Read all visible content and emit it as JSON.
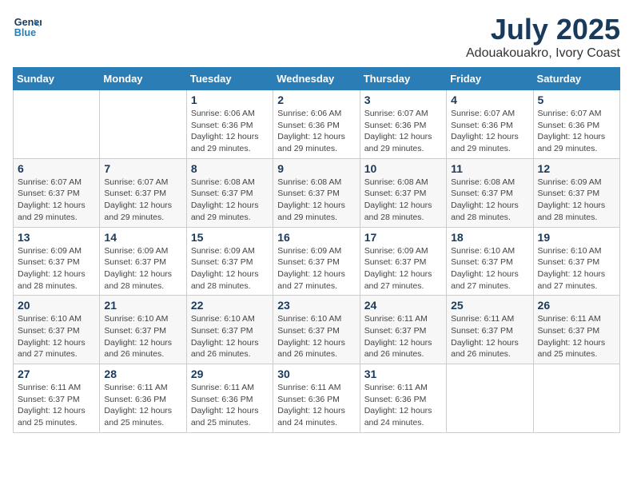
{
  "header": {
    "logo_line1": "General",
    "logo_line2": "Blue",
    "month": "July 2025",
    "location": "Adouakouakro, Ivory Coast"
  },
  "weekdays": [
    "Sunday",
    "Monday",
    "Tuesday",
    "Wednesday",
    "Thursday",
    "Friday",
    "Saturday"
  ],
  "weeks": [
    [
      null,
      null,
      {
        "day": 1,
        "sunrise": "6:06 AM",
        "sunset": "6:36 PM",
        "daylight": "12 hours and 29 minutes."
      },
      {
        "day": 2,
        "sunrise": "6:06 AM",
        "sunset": "6:36 PM",
        "daylight": "12 hours and 29 minutes."
      },
      {
        "day": 3,
        "sunrise": "6:07 AM",
        "sunset": "6:36 PM",
        "daylight": "12 hours and 29 minutes."
      },
      {
        "day": 4,
        "sunrise": "6:07 AM",
        "sunset": "6:36 PM",
        "daylight": "12 hours and 29 minutes."
      },
      {
        "day": 5,
        "sunrise": "6:07 AM",
        "sunset": "6:36 PM",
        "daylight": "12 hours and 29 minutes."
      }
    ],
    [
      {
        "day": 6,
        "sunrise": "6:07 AM",
        "sunset": "6:37 PM",
        "daylight": "12 hours and 29 minutes."
      },
      {
        "day": 7,
        "sunrise": "6:07 AM",
        "sunset": "6:37 PM",
        "daylight": "12 hours and 29 minutes."
      },
      {
        "day": 8,
        "sunrise": "6:08 AM",
        "sunset": "6:37 PM",
        "daylight": "12 hours and 29 minutes."
      },
      {
        "day": 9,
        "sunrise": "6:08 AM",
        "sunset": "6:37 PM",
        "daylight": "12 hours and 29 minutes."
      },
      {
        "day": 10,
        "sunrise": "6:08 AM",
        "sunset": "6:37 PM",
        "daylight": "12 hours and 28 minutes."
      },
      {
        "day": 11,
        "sunrise": "6:08 AM",
        "sunset": "6:37 PM",
        "daylight": "12 hours and 28 minutes."
      },
      {
        "day": 12,
        "sunrise": "6:09 AM",
        "sunset": "6:37 PM",
        "daylight": "12 hours and 28 minutes."
      }
    ],
    [
      {
        "day": 13,
        "sunrise": "6:09 AM",
        "sunset": "6:37 PM",
        "daylight": "12 hours and 28 minutes."
      },
      {
        "day": 14,
        "sunrise": "6:09 AM",
        "sunset": "6:37 PM",
        "daylight": "12 hours and 28 minutes."
      },
      {
        "day": 15,
        "sunrise": "6:09 AM",
        "sunset": "6:37 PM",
        "daylight": "12 hours and 28 minutes."
      },
      {
        "day": 16,
        "sunrise": "6:09 AM",
        "sunset": "6:37 PM",
        "daylight": "12 hours and 27 minutes."
      },
      {
        "day": 17,
        "sunrise": "6:09 AM",
        "sunset": "6:37 PM",
        "daylight": "12 hours and 27 minutes."
      },
      {
        "day": 18,
        "sunrise": "6:10 AM",
        "sunset": "6:37 PM",
        "daylight": "12 hours and 27 minutes."
      },
      {
        "day": 19,
        "sunrise": "6:10 AM",
        "sunset": "6:37 PM",
        "daylight": "12 hours and 27 minutes."
      }
    ],
    [
      {
        "day": 20,
        "sunrise": "6:10 AM",
        "sunset": "6:37 PM",
        "daylight": "12 hours and 27 minutes."
      },
      {
        "day": 21,
        "sunrise": "6:10 AM",
        "sunset": "6:37 PM",
        "daylight": "12 hours and 26 minutes."
      },
      {
        "day": 22,
        "sunrise": "6:10 AM",
        "sunset": "6:37 PM",
        "daylight": "12 hours and 26 minutes."
      },
      {
        "day": 23,
        "sunrise": "6:10 AM",
        "sunset": "6:37 PM",
        "daylight": "12 hours and 26 minutes."
      },
      {
        "day": 24,
        "sunrise": "6:11 AM",
        "sunset": "6:37 PM",
        "daylight": "12 hours and 26 minutes."
      },
      {
        "day": 25,
        "sunrise": "6:11 AM",
        "sunset": "6:37 PM",
        "daylight": "12 hours and 26 minutes."
      },
      {
        "day": 26,
        "sunrise": "6:11 AM",
        "sunset": "6:37 PM",
        "daylight": "12 hours and 25 minutes."
      }
    ],
    [
      {
        "day": 27,
        "sunrise": "6:11 AM",
        "sunset": "6:37 PM",
        "daylight": "12 hours and 25 minutes."
      },
      {
        "day": 28,
        "sunrise": "6:11 AM",
        "sunset": "6:36 PM",
        "daylight": "12 hours and 25 minutes."
      },
      {
        "day": 29,
        "sunrise": "6:11 AM",
        "sunset": "6:36 PM",
        "daylight": "12 hours and 25 minutes."
      },
      {
        "day": 30,
        "sunrise": "6:11 AM",
        "sunset": "6:36 PM",
        "daylight": "12 hours and 24 minutes."
      },
      {
        "day": 31,
        "sunrise": "6:11 AM",
        "sunset": "6:36 PM",
        "daylight": "12 hours and 24 minutes."
      },
      null,
      null
    ]
  ]
}
